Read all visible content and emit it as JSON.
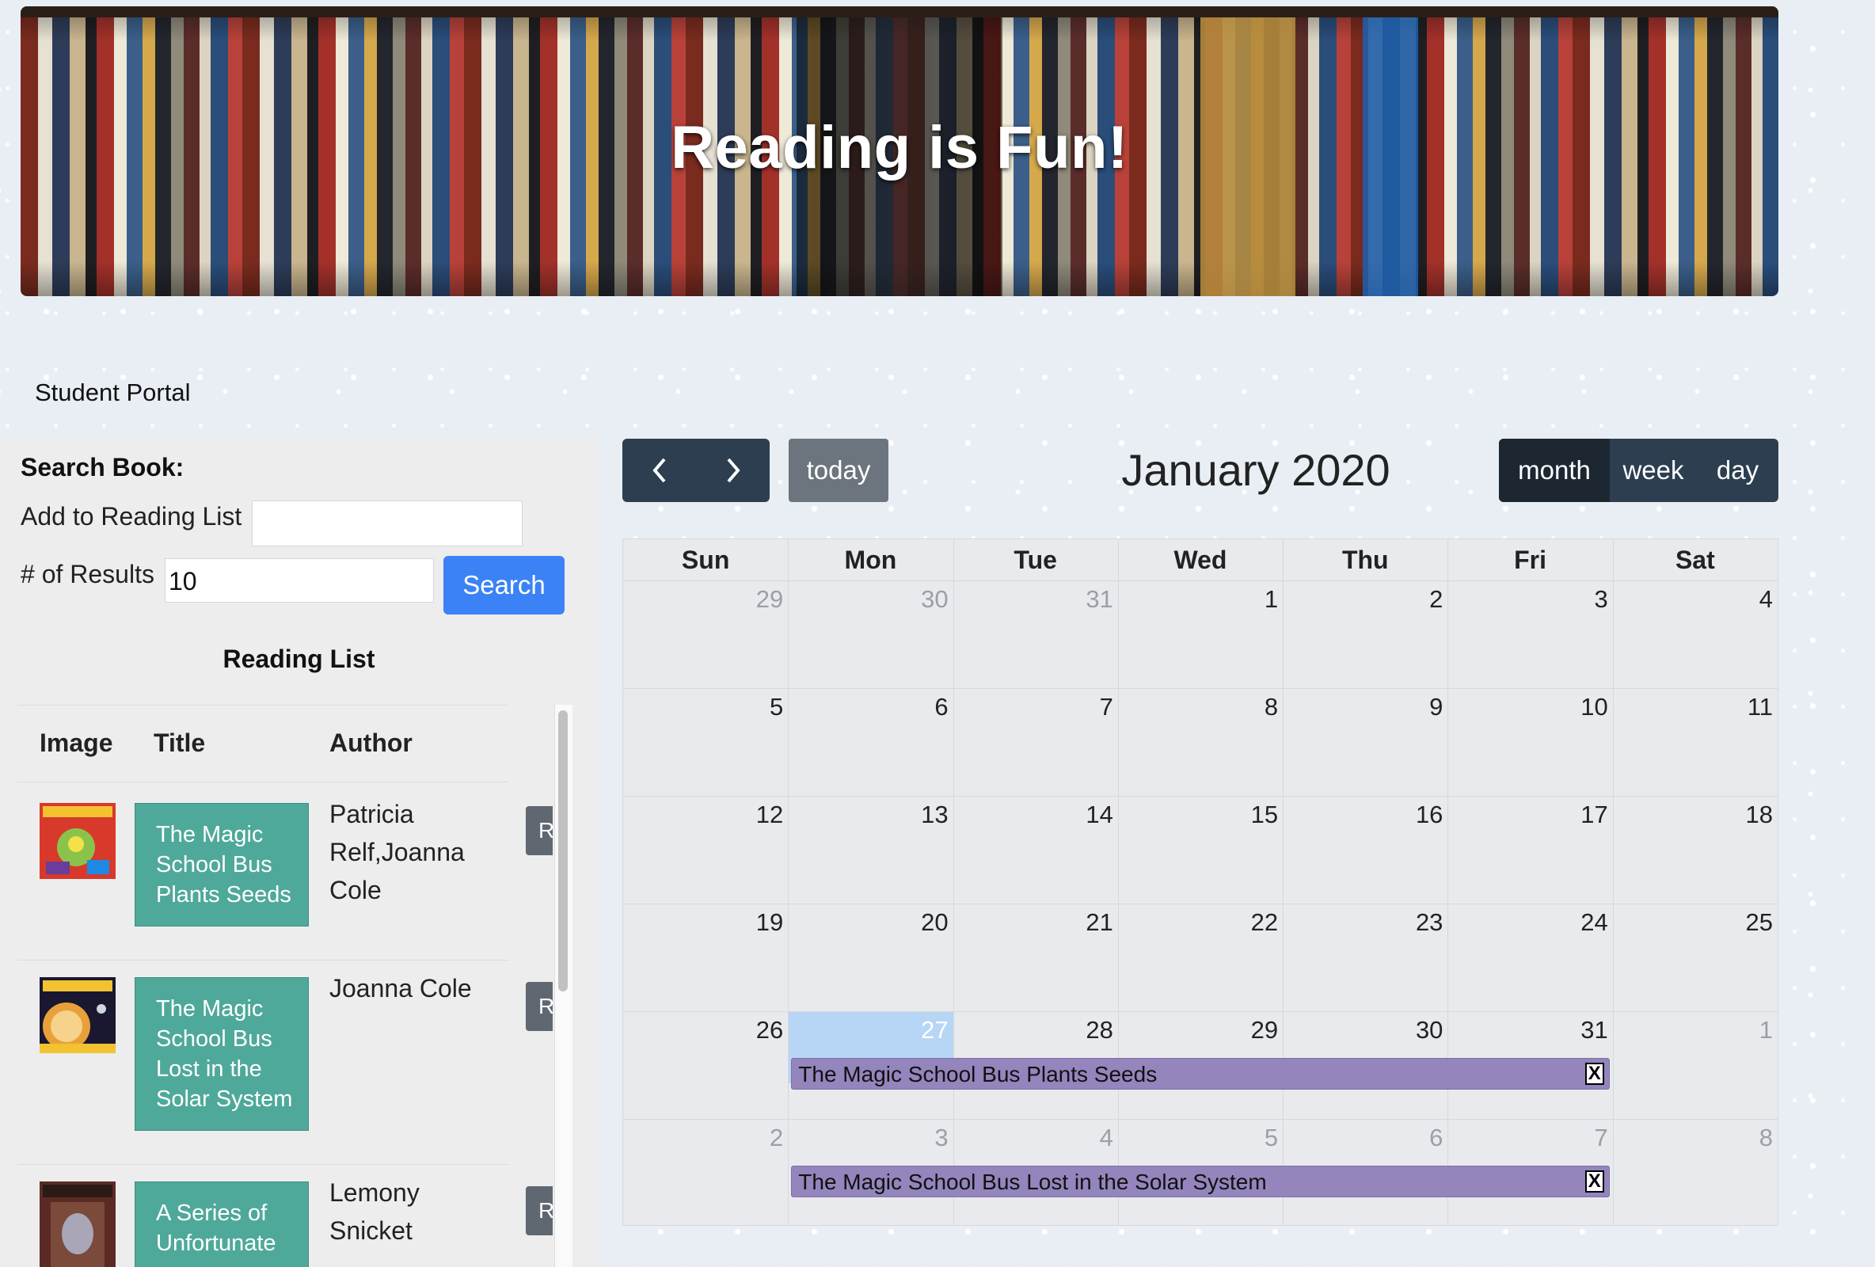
{
  "banner": {
    "title": "Reading is Fun!"
  },
  "portal_label": "Student Portal",
  "search": {
    "heading": "Search Book:",
    "add_label": "Add to Reading List",
    "add_value": "",
    "results_label": "# of Results",
    "results_value": "10",
    "button": "Search"
  },
  "reading_list": {
    "title": "Reading List",
    "columns": [
      "Image",
      "Title",
      "Author"
    ],
    "rows": [
      {
        "title": "The Magic School Bus Plants Seeds",
        "author": "Patricia Relf,Joanna Cole",
        "action": "R"
      },
      {
        "title": "The Magic School Bus Lost in the Solar System",
        "author": "Joanna Cole",
        "action": "R"
      },
      {
        "title": "A Series of Unfortunate",
        "author": "Lemony Snicket",
        "action": "R"
      }
    ]
  },
  "calendar": {
    "prev_icon": "chevron-left-icon",
    "next_icon": "chevron-right-icon",
    "today_label": "today",
    "title": "January 2020",
    "views": [
      "month",
      "week",
      "day"
    ],
    "active_view": "month",
    "weekdays": [
      "Sun",
      "Mon",
      "Tue",
      "Wed",
      "Thu",
      "Fri",
      "Sat"
    ],
    "weeks": [
      [
        "29",
        "30",
        "31",
        "1",
        "2",
        "3",
        "4"
      ],
      [
        "5",
        "6",
        "7",
        "8",
        "9",
        "10",
        "11"
      ],
      [
        "12",
        "13",
        "14",
        "15",
        "16",
        "17",
        "18"
      ],
      [
        "19",
        "20",
        "21",
        "22",
        "23",
        "24",
        "25"
      ],
      [
        "26",
        "27",
        "28",
        "29",
        "30",
        "31",
        "1"
      ],
      [
        "2",
        "3",
        "4",
        "5",
        "6",
        "7",
        "8"
      ]
    ],
    "today_date": "27",
    "events": [
      {
        "title": "The Magic School Bus Plants Seeds",
        "close": "X"
      },
      {
        "title": "The Magic School Bus Lost in the Solar System",
        "close": "X"
      }
    ],
    "colors": {
      "event": "#9485bd",
      "today": "#b7d6f6",
      "toolbar": "#2c3e50"
    }
  }
}
